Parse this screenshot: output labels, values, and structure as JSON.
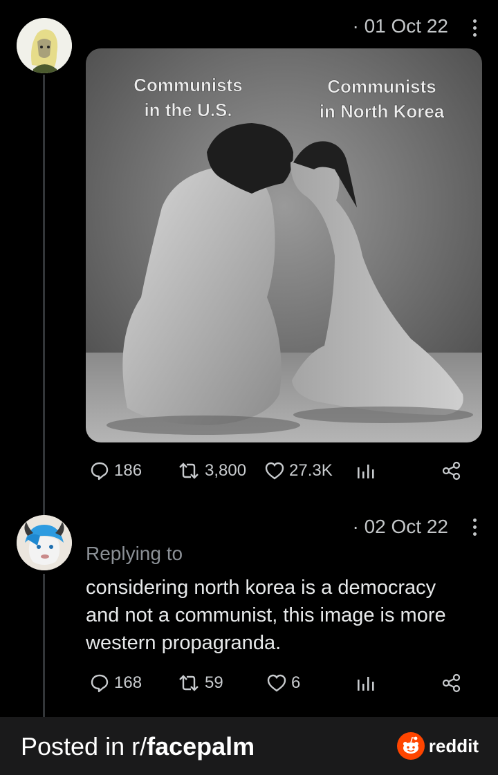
{
  "post": {
    "date": "· 01 Oct 22",
    "image": {
      "caption_left_line1": "Communists",
      "caption_left_line2": "in the U.S.",
      "caption_right_line1": "Communists",
      "caption_right_line2": "in North Korea"
    },
    "stats": {
      "replies": "186",
      "reposts": "3,800",
      "likes": "27.3K"
    }
  },
  "reply": {
    "date": "· 02 Oct 22",
    "replying_to": "Replying to",
    "text": "considering north korea is a democracy and not a communist, this image is more western propagranda.",
    "stats": {
      "replies": "168",
      "reposts": "59",
      "likes": "6"
    }
  },
  "footer": {
    "posted_in": "Posted in r/",
    "subreddit": "facepalm",
    "brand": "reddit",
    "brand_color": "#ff4500"
  }
}
